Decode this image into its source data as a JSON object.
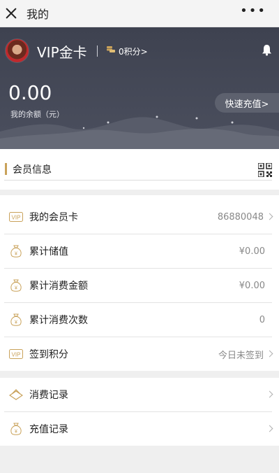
{
  "nav": {
    "title": "我的",
    "more": "•••"
  },
  "header": {
    "card_name": "VIP金卡",
    "points": "0积分>",
    "balance": "0.00",
    "balance_label": "我的余额（元）",
    "recharge": "快速充值>"
  },
  "member_info": {
    "label": "会员信息"
  },
  "rows": [
    {
      "label": "我的会员卡",
      "value": "86880048",
      "icon": "vip-icon"
    },
    {
      "label": "累计储值",
      "value": "¥0.00",
      "icon": "money-bag-icon"
    },
    {
      "label": "累计消费金额",
      "value": "¥0.00",
      "icon": "money-bag-icon"
    },
    {
      "label": "累计消费次数",
      "value": "0",
      "icon": "money-bag-icon"
    },
    {
      "label": "签到积分",
      "value": "今日未签到",
      "icon": "vip-icon"
    }
  ],
  "records": [
    {
      "label": "消费记录",
      "icon": "stack-icon"
    },
    {
      "label": "充值记录",
      "icon": "money-bag-icon"
    }
  ],
  "colors": {
    "header_bg": "#44485a",
    "accent_gold": "#c9a25a"
  }
}
